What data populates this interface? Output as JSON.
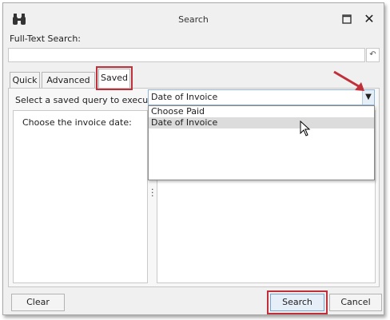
{
  "window": {
    "title": "Search"
  },
  "icons": {
    "app": "binoculars-icon",
    "maximize": "maximize-icon",
    "close": "close-icon",
    "clear_text": "undo-icon",
    "dropdown": "chevron-down-icon",
    "cursor": "mouse-pointer-icon",
    "annotation": "red-arrow-icon"
  },
  "full_text_search": {
    "label": "Full-Text Search:",
    "value": ""
  },
  "tabs": [
    {
      "label": "Quick"
    },
    {
      "label": "Advanced"
    },
    {
      "label": "Saved",
      "active": true
    }
  ],
  "saved": {
    "select_label": "Select a saved query to execute:",
    "selected_value": "Date of Invoice",
    "options": [
      "Choose Paid",
      "Date of Invoice"
    ],
    "highlighted_option": "Date of Invoice",
    "prompt": "Choose the invoice date:"
  },
  "buttons": {
    "clear": "Clear",
    "search": "Search",
    "cancel": "Cancel"
  },
  "colors": {
    "highlight_red": "#c0303a",
    "accent_blue": "#7da2ce"
  }
}
